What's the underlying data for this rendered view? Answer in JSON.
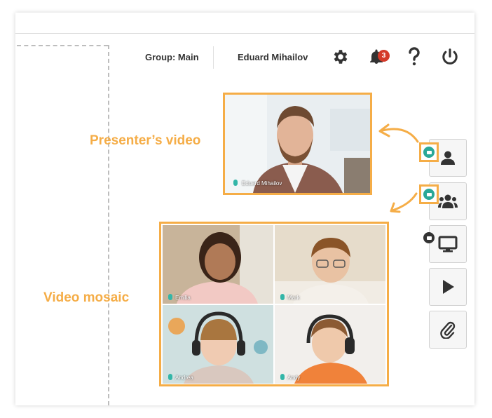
{
  "header": {
    "group_label": "Group: Main",
    "user_name": "Eduard Mihailov",
    "notification_count": "3"
  },
  "presenter": {
    "name": "Eduard Mihailov"
  },
  "mosaic": {
    "tiles": [
      {
        "name": "Emilia"
      },
      {
        "name": "Mark"
      },
      {
        "name": "Andrea"
      },
      {
        "name": "Andy"
      }
    ]
  },
  "annotations": {
    "presenter_label": "Presenter’s video",
    "mosaic_label": "Video mosaic"
  },
  "colors": {
    "accent": "#f5ad47",
    "camera_on": "#2aa898",
    "badge": "#d43a2a"
  },
  "sidebar": {
    "buttons": [
      {
        "icon": "user-icon"
      },
      {
        "icon": "users-icon"
      },
      {
        "icon": "monitor-icon"
      },
      {
        "icon": "play-icon"
      },
      {
        "icon": "paperclip-icon"
      }
    ]
  }
}
